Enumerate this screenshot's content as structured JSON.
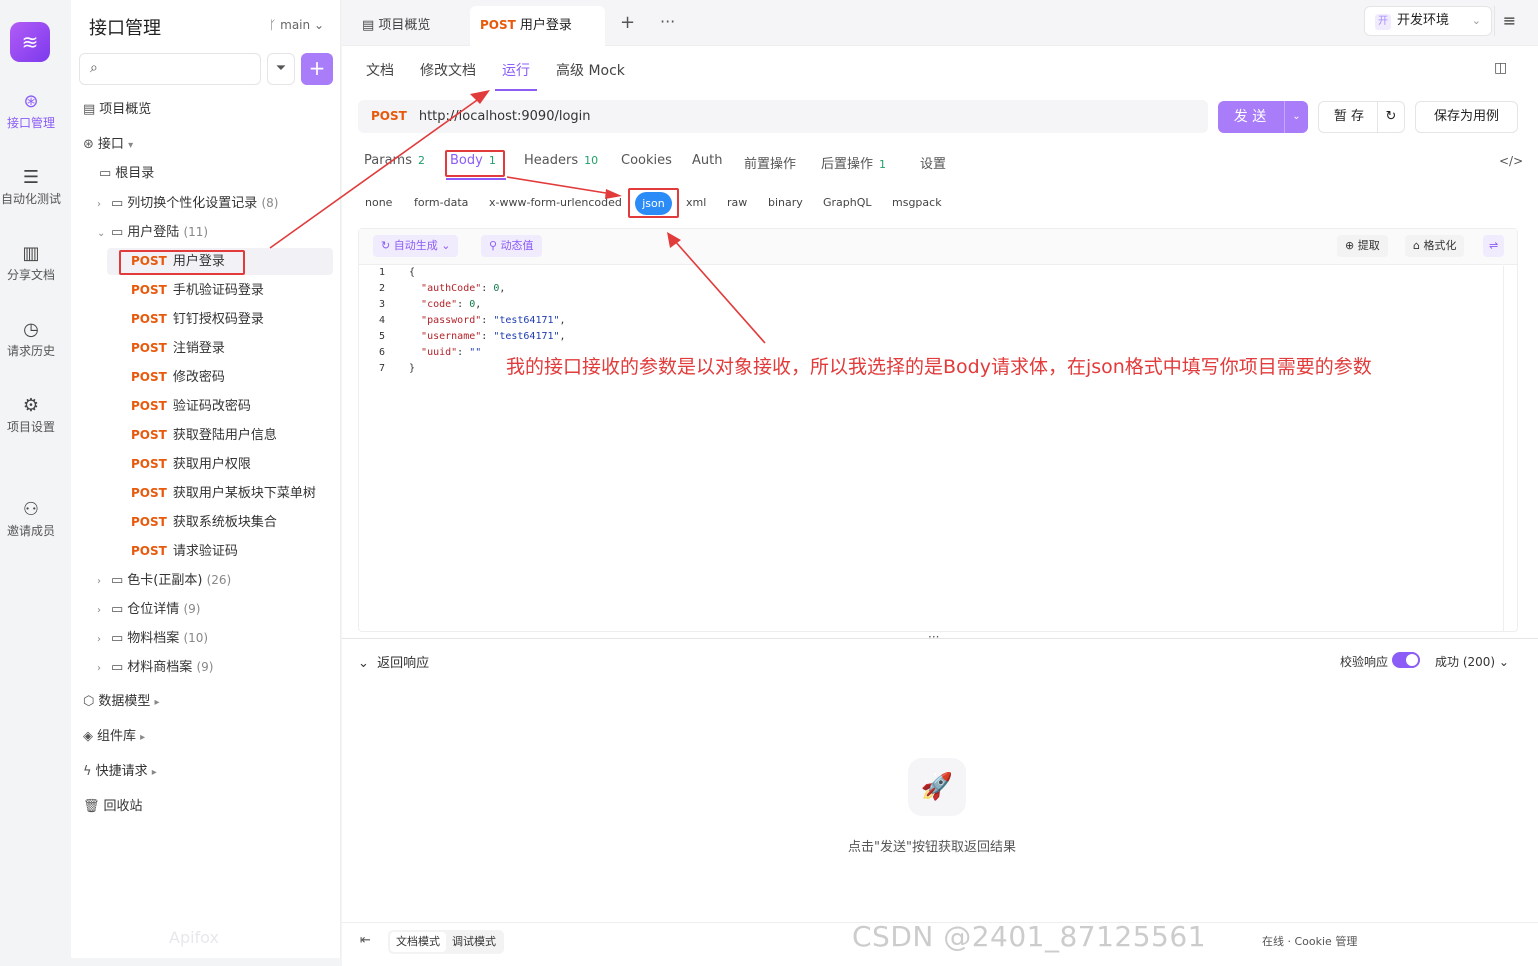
{
  "rail": {
    "items": [
      {
        "label": "接口管理",
        "icon": "api-icon",
        "active": true
      },
      {
        "label": "自动化测试",
        "icon": "automation-icon"
      },
      {
        "label": "分享文档",
        "icon": "book-icon"
      },
      {
        "label": "请求历史",
        "icon": "clock-icon"
      },
      {
        "label": "项目设置",
        "icon": "gear-icon"
      },
      {
        "label": "邀请成员",
        "icon": "add-user-icon"
      }
    ]
  },
  "sidebar": {
    "title": "接口管理",
    "branch": "main",
    "overview": "项目概览",
    "api_root": "接口",
    "root_dir": "根目录",
    "folders_top": [
      {
        "name": "列切换个性化设置记录",
        "count": "(8)"
      },
      {
        "name": "用户登陆",
        "count": "(11)"
      }
    ],
    "endpoints": [
      {
        "method": "POST",
        "name": "用户登录"
      },
      {
        "method": "POST",
        "name": "手机验证码登录"
      },
      {
        "method": "POST",
        "name": "钉钉授权码登录"
      },
      {
        "method": "POST",
        "name": "注销登录"
      },
      {
        "method": "POST",
        "name": "修改密码"
      },
      {
        "method": "POST",
        "name": "验证码改密码"
      },
      {
        "method": "POST",
        "name": "获取登陆用户信息"
      },
      {
        "method": "POST",
        "name": "获取用户权限"
      },
      {
        "method": "POST",
        "name": "获取用户某板块下菜单树"
      },
      {
        "method": "POST",
        "name": "获取系统板块集合"
      },
      {
        "method": "POST",
        "name": "请求验证码"
      }
    ],
    "folders_bottom": [
      {
        "name": "色卡(正副本)",
        "count": "(26)"
      },
      {
        "name": "仓位详情",
        "count": "(9)"
      },
      {
        "name": "物料档案",
        "count": "(10)"
      },
      {
        "name": "材料商档案",
        "count": "(9)"
      }
    ],
    "sections": [
      {
        "label": "数据模型",
        "icon": "cube-icon"
      },
      {
        "label": "组件库",
        "icon": "layers-icon"
      },
      {
        "label": "快捷请求",
        "icon": "bolt-icon"
      },
      {
        "label": "回收站",
        "icon": "trash-icon"
      }
    ],
    "watermark": "Apifox"
  },
  "tabs": {
    "overview": "项目概览",
    "active_method": "POST",
    "active_name": "用户登录",
    "env": "开发环境",
    "env_badge": "开"
  },
  "subtabs": [
    "文档",
    "修改文档",
    "运行",
    "高级 Mock"
  ],
  "request": {
    "method": "POST",
    "url": "http://localhost:9090/login",
    "send": "发 送",
    "save": "暂 存",
    "save_case": "保存为用例"
  },
  "req_tabs": [
    {
      "label": "Params",
      "count": "2"
    },
    {
      "label": "Body",
      "count": "1"
    },
    {
      "label": "Headers",
      "count": "10"
    },
    {
      "label": "Cookies",
      "count": ""
    },
    {
      "label": "Auth",
      "count": ""
    },
    {
      "label": "前置操作",
      "count": ""
    },
    {
      "label": "后置操作",
      "count": "1"
    },
    {
      "label": "设置",
      "count": ""
    }
  ],
  "body_types": [
    "none",
    "form-data",
    "x-www-form-urlencoded",
    "json",
    "xml",
    "raw",
    "binary",
    "GraphQL",
    "msgpack"
  ],
  "editor": {
    "auto_gen": "自动生成",
    "dynamic": "动态值",
    "extract": "提取",
    "format": "格式化",
    "line_numbers": [
      "1",
      "2",
      "3",
      "4",
      "5",
      "6",
      "7"
    ]
  },
  "annotation": "我的接口接收的参数是以对象接收，所以我选择的是Body请求体，在json格式中填写你项目需要的参数",
  "response": {
    "title": "返回响应",
    "verify": "校验响应",
    "status": "成功 (200)",
    "empty_hint": "点击\"发送\"按钮获取返回结果"
  },
  "footer": {
    "modes": [
      "文档模式",
      "调试模式"
    ],
    "right": "在线 · Cookie 管理"
  },
  "watermark": "CSDN @2401_87125561"
}
